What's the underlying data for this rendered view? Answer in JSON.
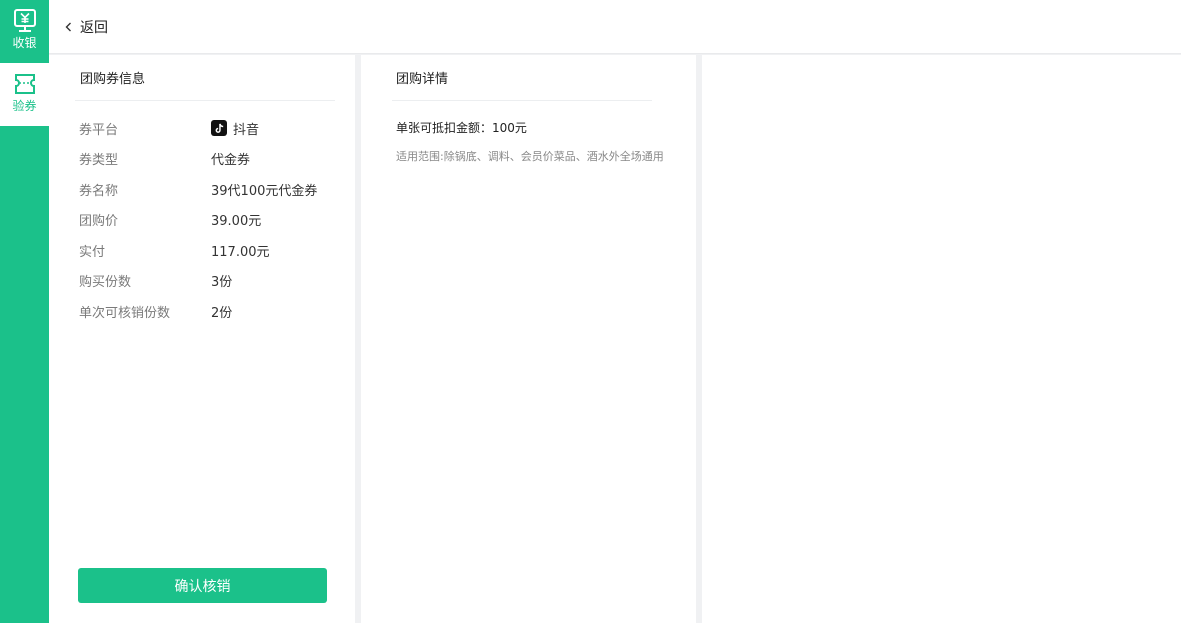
{
  "sidebar": {
    "items": [
      {
        "label": "收银",
        "icon": "cashier-monitor-icon",
        "active": false
      },
      {
        "label": "验券",
        "icon": "ticket-verify-icon",
        "active": true
      }
    ]
  },
  "topbar": {
    "back_label": "返回"
  },
  "info_panel": {
    "title": "团购券信息",
    "rows": [
      {
        "key": "券平台",
        "value": "抖音",
        "icon": "tiktok-logo-icon"
      },
      {
        "key": "券类型",
        "value": "代金券"
      },
      {
        "key": "券名称",
        "value": "39代100元代金券"
      },
      {
        "key": "团购价",
        "value": "39.00元"
      },
      {
        "key": "实付",
        "value": "117.00元"
      },
      {
        "key": "购买份数",
        "value": "3份"
      },
      {
        "key": "单次可核销份数",
        "value": "2份"
      }
    ],
    "confirm_label": "确认核销"
  },
  "detail_panel": {
    "title": "团购详情",
    "amount_text": "单张可抵扣金额：100元",
    "scope_text": "适用范围:除锅底、调料、会员价菜品、酒水外全场通用"
  },
  "colors": {
    "accent": "#1bc18a",
    "background": "#f0f1f3"
  }
}
